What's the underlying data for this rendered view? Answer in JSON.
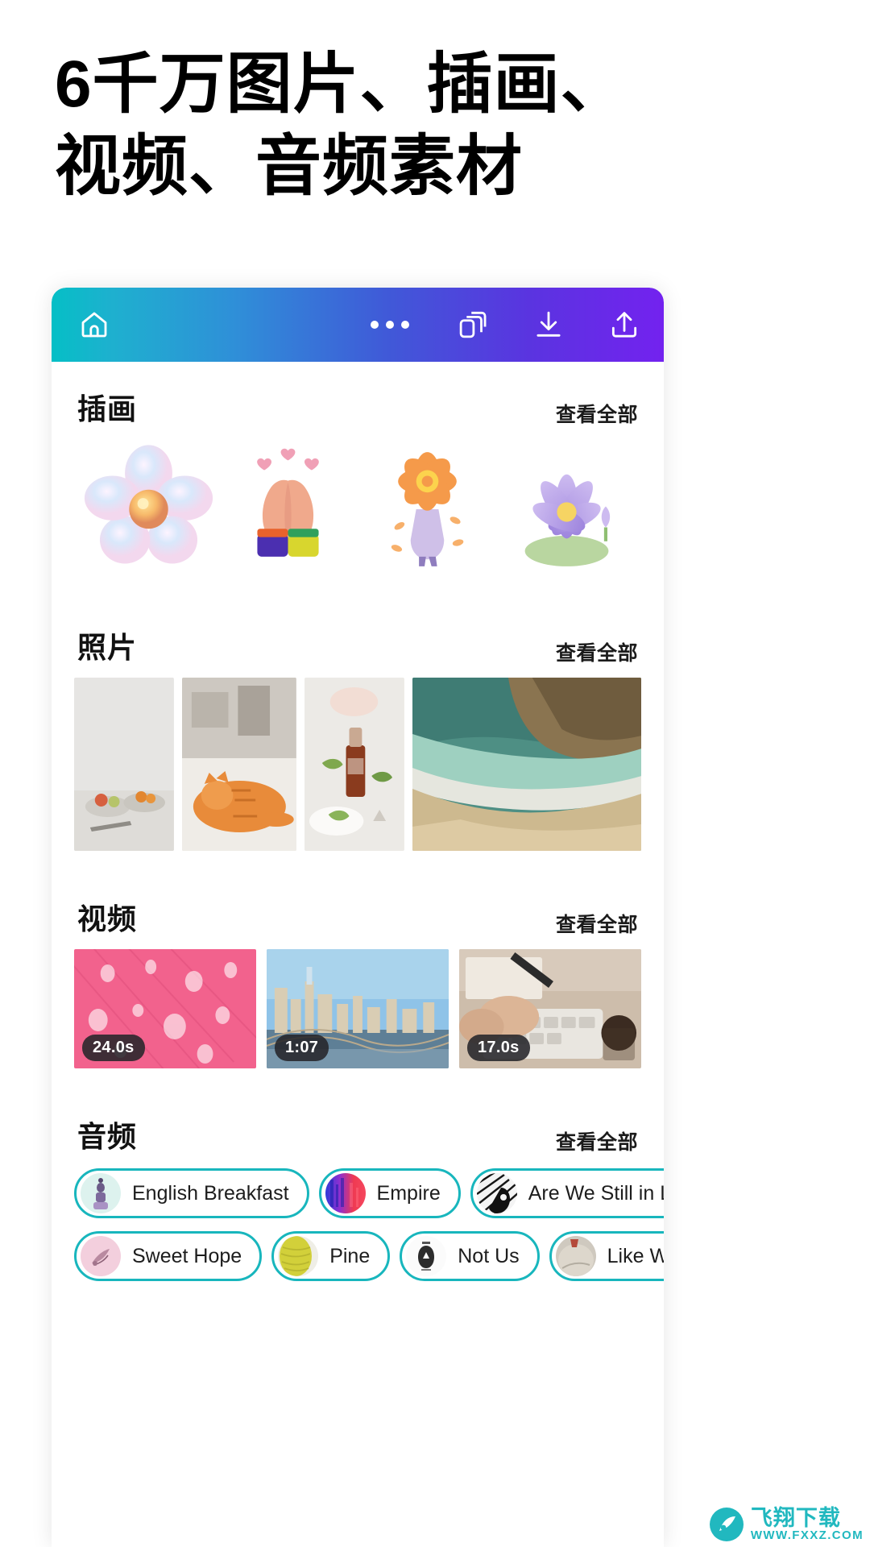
{
  "headline": {
    "line1": "6千万图片、插画、",
    "line2": "视频、音频素材"
  },
  "toolbar": {
    "home_icon": "home-icon",
    "more_icon": "more-dots-icon",
    "layers_icon": "duplicate-layers-icon",
    "download_icon": "download-icon",
    "upload_icon": "upload-icon",
    "gradient_from": "#05bfc6",
    "gradient_to": "#7322ef"
  },
  "sections": {
    "illustration": {
      "title": "插画",
      "view_all": "查看全部",
      "items": [
        {
          "name": "iridescent-flower-illustration"
        },
        {
          "name": "praying-hands-illustration"
        },
        {
          "name": "flower-girl-illustration"
        },
        {
          "name": "purple-lotus-illustration"
        }
      ]
    },
    "photo": {
      "title": "照片",
      "view_all": "查看全部",
      "items": [
        {
          "name": "fruit-bowls-photo"
        },
        {
          "name": "orange-cat-photo"
        },
        {
          "name": "serum-bottle-photo"
        },
        {
          "name": "ocean-beach-photo"
        }
      ]
    },
    "video": {
      "title": "视频",
      "view_all": "查看全部",
      "items": [
        {
          "name": "pink-petal-raindrops-video",
          "duration": "24.0s"
        },
        {
          "name": "city-skyline-bridge-video",
          "duration": "1:07"
        },
        {
          "name": "hands-typing-keyboard-video",
          "duration": "17.0s"
        }
      ]
    },
    "audio": {
      "title": "音频",
      "view_all": "查看全部",
      "rows": [
        [
          {
            "label": "English Breakfast",
            "thumb": "english-breakfast-cover"
          },
          {
            "label": "Empire",
            "thumb": "empire-cover"
          },
          {
            "label": "Are We Still in Love",
            "thumb": "are-we-still-in-love-cover"
          }
        ],
        [
          {
            "label": "Sweet Hope",
            "thumb": "sweet-hope-cover"
          },
          {
            "label": "Pine",
            "thumb": "pine-cover"
          },
          {
            "label": "Not Us",
            "thumb": "not-us-cover"
          },
          {
            "label": "Like Whoa",
            "thumb": "like-whoa-cover"
          }
        ]
      ]
    }
  },
  "watermark": {
    "cn": "飞翔下载",
    "en": "WWW.FXXZ.COM",
    "color": "#18b6bd"
  }
}
